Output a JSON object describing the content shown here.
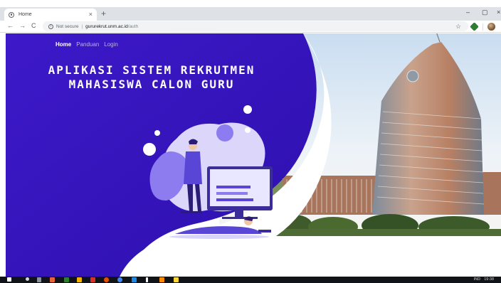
{
  "browser": {
    "tab_title": "Home",
    "tab_close": "×",
    "new_tab": "+",
    "window_minimize": "–",
    "window_restore": "▢",
    "window_close": "×",
    "back": "←",
    "forward": "→",
    "reload": "C",
    "security_label": "Not secure",
    "url_host": "gururekrut.unm.ac.id",
    "url_path": "/auth",
    "bookmark_star": "☆"
  },
  "site": {
    "nav": [
      {
        "label": "Home"
      },
      {
        "label": "Panduan"
      },
      {
        "label": "Login"
      }
    ],
    "title_line1": "APLIKASI SISTEM REKRUTMEN",
    "title_line2": "MAHASISWA CALON GURU"
  },
  "colors": {
    "brand_purple": "#3a17c4",
    "brand_purple_dark": "#2f0fb0",
    "accent_lilac": "#8c7cf2",
    "sky": "#dbe9f5"
  },
  "taskbar": {
    "tray_lang": "IND",
    "tray_time": "19:38"
  }
}
